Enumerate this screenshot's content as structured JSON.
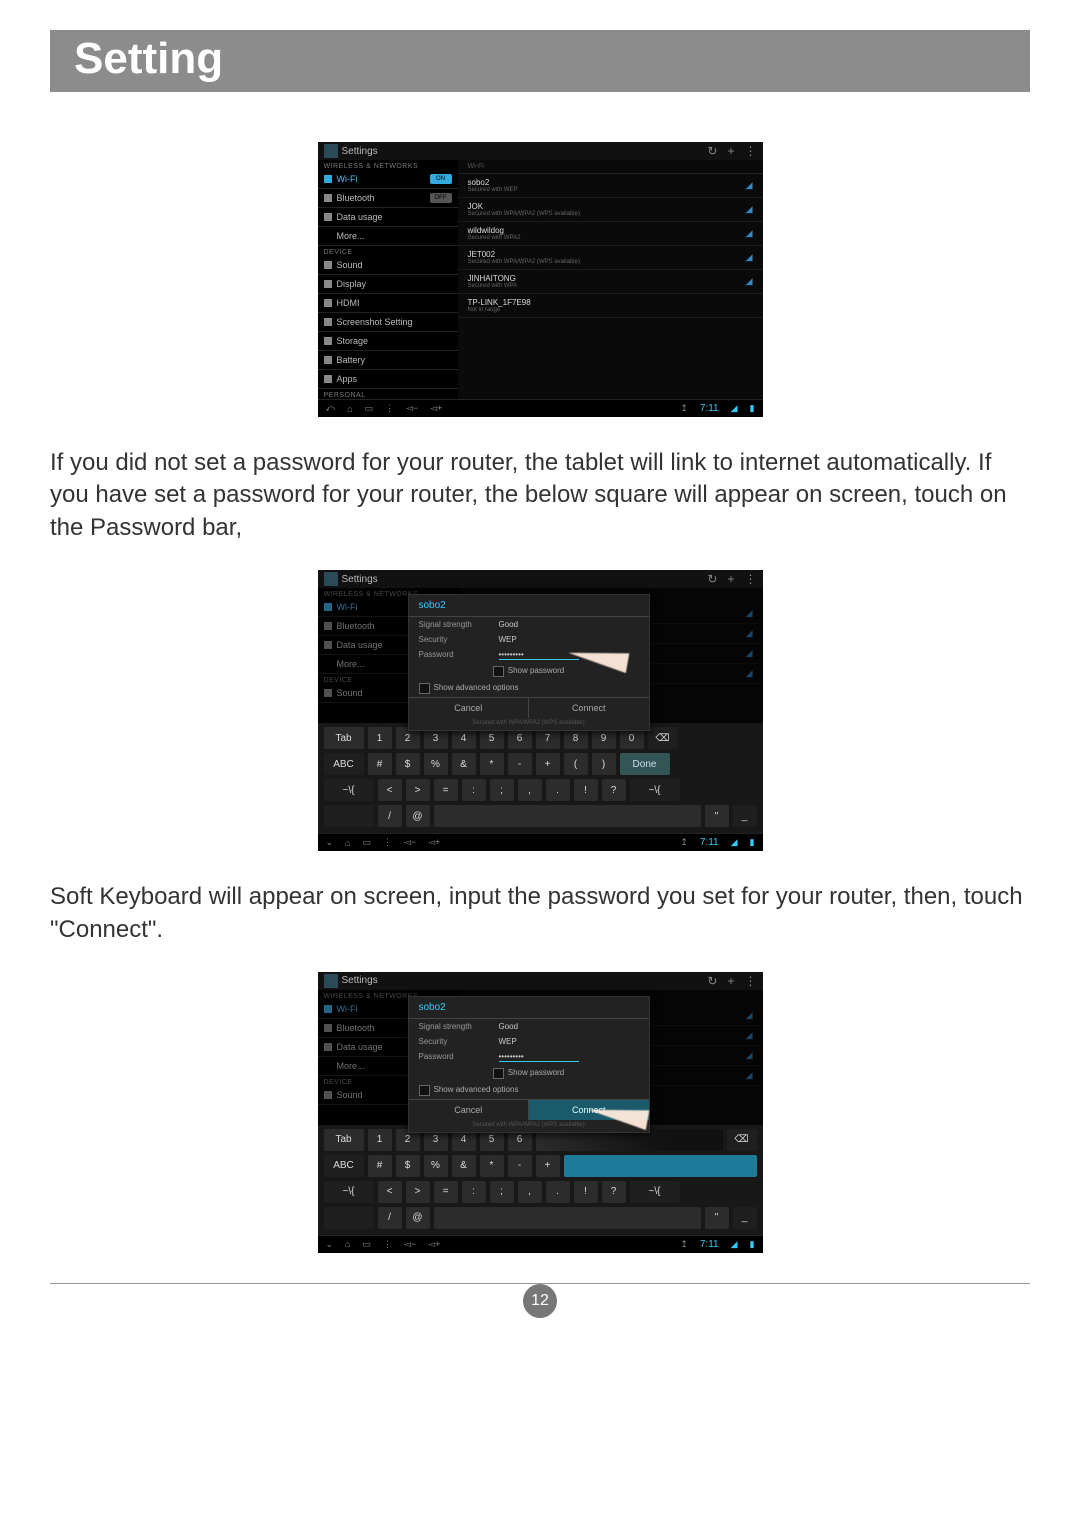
{
  "page": {
    "title": "Setting",
    "number": "12"
  },
  "para1": "If you did not set a password for your router, the tablet will link to internet automatically. If you have set a password for your router, the below square will appear on screen, touch on the Password bar,",
  "para2": "Soft Keyboard will appear on screen, input the password you set for your router, then, touch \"Connect\".",
  "topbar": {
    "title": "Settings",
    "iconRefresh": "↻",
    "iconPlus": "+",
    "iconMenu": "⋮"
  },
  "sidebar": {
    "sectionWireless": "WIRELESS & NETWORKS",
    "sectionDevice": "DEVICE",
    "sectionPersonal": "PERSONAL",
    "wifi": "Wi-Fi",
    "bluetooth": "Bluetooth",
    "data": "Data usage",
    "more": "More...",
    "sound": "Sound",
    "display": "Display",
    "hdmi": "HDMI",
    "screenshot": "Screenshot Setting",
    "storage": "Storage",
    "battery": "Battery",
    "apps": "Apps",
    "toggleOn": "ON",
    "toggleOff": "OFF"
  },
  "mainHeader": "Wi-Fi",
  "networks": [
    {
      "name": "sobo2",
      "sub": "Secured with WEP"
    },
    {
      "name": "JOK",
      "sub": "Secured with WPA/WPA2 (WPS available)"
    },
    {
      "name": "wildwildog",
      "sub": "Secured with WPA2"
    },
    {
      "name": "JET002",
      "sub": "Secured with WPA/WPA2 (WPS available)"
    },
    {
      "name": "JINHAITONG",
      "sub": "Secured with WPA"
    },
    {
      "name": "TP-LINK_1F7E98",
      "sub": "Not in range"
    }
  ],
  "nav": {
    "time": "7:11"
  },
  "dialog": {
    "title": "sobo2",
    "signalLbl": "Signal strength",
    "signalVal": "Good",
    "securityLbl": "Security",
    "securityVal": "WEP",
    "passwordLbl": "Password",
    "passwordVal": "•••••••••",
    "showPwd": "Show password",
    "advanced": "Show advanced options",
    "cancel": "Cancel",
    "connect": "Connect",
    "foot": "Secured with WPA/WPA2 (WPS available)"
  },
  "kb": {
    "tab": "Tab",
    "abc": "ABC",
    "done": "Done",
    "sym": "~\\{",
    "symR": "~\\{",
    "r1": [
      "1",
      "2",
      "3",
      "4",
      "5",
      "6",
      "7",
      "8",
      "9",
      "0"
    ],
    "r2": [
      "#",
      "$",
      "%",
      "&",
      "*",
      "-",
      "+",
      "(",
      ")"
    ],
    "r3": [
      "<",
      ">",
      "=",
      ":",
      ";",
      ",",
      ".",
      "!",
      "?"
    ],
    "r4": [
      "/",
      "@"
    ],
    "bksp": "⌫",
    "quote": "\"",
    "under": "_",
    "trailKeys_b": [
      "5",
      "6"
    ]
  }
}
